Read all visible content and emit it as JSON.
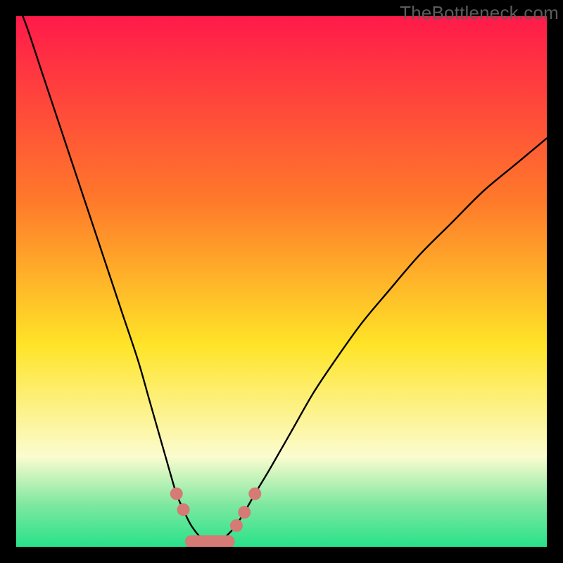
{
  "watermark": "TheBottleneck.com",
  "colors": {
    "frame_bg": "#000000",
    "gradient_top": "#ff1a4a",
    "gradient_mid1": "#ff7a2a",
    "gradient_mid2": "#ffe428",
    "gradient_pale": "#fbfccf",
    "gradient_green1": "#7fe8a0",
    "gradient_green2": "#28e28a",
    "curve_stroke": "#000000",
    "marker_fill": "#d57a74",
    "watermark_text": "#5c5c5c"
  },
  "chart_data": {
    "type": "line",
    "title": "",
    "xlabel": "",
    "ylabel": "",
    "xlim": [
      0,
      100
    ],
    "ylim": [
      0,
      100
    ],
    "series": [
      {
        "name": "bottleneck-curve-left",
        "x": [
          0,
          2,
          5,
          8,
          11,
          14,
          17,
          20,
          23,
          25,
          27,
          29,
          30.2,
          31.5,
          33,
          35,
          37
        ],
        "values": [
          103,
          98,
          89,
          80,
          71,
          62,
          53,
          44,
          35,
          28,
          21,
          14,
          10,
          7,
          4,
          1.5,
          0
        ]
      },
      {
        "name": "bottleneck-curve-right",
        "x": [
          37,
          39,
          41,
          43,
          45,
          48,
          52,
          56,
          60,
          65,
          70,
          76,
          82,
          88,
          94,
          100
        ],
        "values": [
          0,
          1.5,
          3.5,
          6.5,
          10,
          15,
          22,
          29,
          35,
          42,
          48,
          55,
          61,
          67,
          72,
          77
        ]
      }
    ],
    "markers": [
      {
        "x": 30.2,
        "y": 10.0
      },
      {
        "x": 31.5,
        "y": 7.0
      },
      {
        "x": 41.5,
        "y": 4.0
      },
      {
        "x": 43.0,
        "y": 6.5
      },
      {
        "x": 45.0,
        "y": 10.0
      }
    ],
    "capsule": {
      "x_start": 33.0,
      "x_end": 40.0,
      "y": 1.0
    },
    "ideal_band": {
      "y_start": 0,
      "y_end": 18
    },
    "gradient_stops": [
      {
        "pct": 0,
        "key": "gradient_top"
      },
      {
        "pct": 35,
        "key": "gradient_mid1"
      },
      {
        "pct": 62,
        "key": "gradient_mid2"
      },
      {
        "pct": 83,
        "key": "gradient_pale"
      },
      {
        "pct": 92,
        "key": "gradient_green1"
      },
      {
        "pct": 100,
        "key": "gradient_green2"
      }
    ]
  }
}
